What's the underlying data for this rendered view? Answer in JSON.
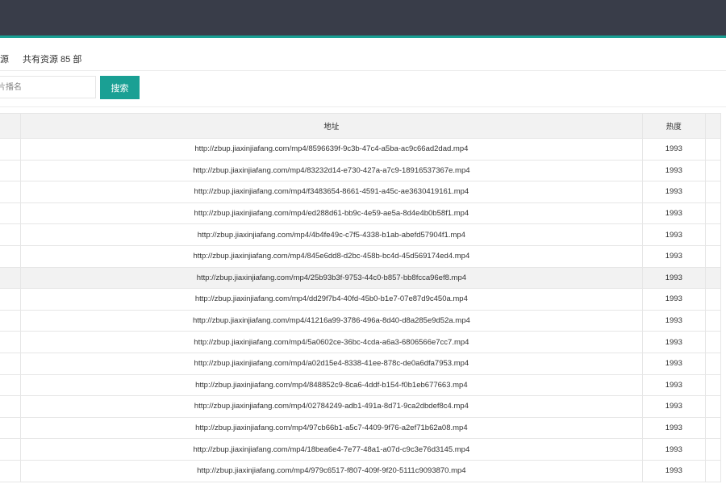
{
  "info": {
    "source_tail": "源",
    "total_text": "共有资源 85 部"
  },
  "search": {
    "placeholder": "片播名",
    "button_label": "搜索"
  },
  "table": {
    "columns": [
      "",
      "地址",
      "热度",
      ""
    ],
    "rows": [
      {
        "url": "http://zbup.jiaxinjiafang.com/mp4/8596639f-9c3b-47c4-a5ba-ac9c66ad2dad.mp4",
        "heat": "1993"
      },
      {
        "url": "http://zbup.jiaxinjiafang.com/mp4/83232d14-e730-427a-a7c9-18916537367e.mp4",
        "heat": "1993"
      },
      {
        "url": "http://zbup.jiaxinjiafang.com/mp4/f3483654-8661-4591-a45c-ae3630419161.mp4",
        "heat": "1993"
      },
      {
        "url": "http://zbup.jiaxinjiafang.com/mp4/ed288d61-bb9c-4e59-ae5a-8d4e4b0b58f1.mp4",
        "heat": "1993"
      },
      {
        "url": "http://zbup.jiaxinjiafang.com/mp4/4b4fe49c-c7f5-4338-b1ab-abefd57904f1.mp4",
        "heat": "1993"
      },
      {
        "url": "http://zbup.jiaxinjiafang.com/mp4/845e6dd8-d2bc-458b-bc4d-45d569174ed4.mp4",
        "heat": "1993"
      },
      {
        "url": "http://zbup.jiaxinjiafang.com/mp4/25b93b3f-9753-44c0-b857-bb8fcca96ef8.mp4",
        "heat": "1993"
      },
      {
        "url": "http://zbup.jiaxinjiafang.com/mp4/dd29f7b4-40fd-45b0-b1e7-07e87d9c450a.mp4",
        "heat": "1993"
      },
      {
        "url": "http://zbup.jiaxinjiafang.com/mp4/41216a99-3786-496a-8d40-d8a285e9d52a.mp4",
        "heat": "1993"
      },
      {
        "url": "http://zbup.jiaxinjiafang.com/mp4/5a0602ce-36bc-4cda-a6a3-6806566e7cc7.mp4",
        "heat": "1993"
      },
      {
        "url": "http://zbup.jiaxinjiafang.com/mp4/a02d15e4-8338-41ee-878c-de0a6dfa7953.mp4",
        "heat": "1993"
      },
      {
        "url": "http://zbup.jiaxinjiafang.com/mp4/848852c9-8ca6-4ddf-b154-f0b1eb677663.mp4",
        "heat": "1993"
      },
      {
        "url": "http://zbup.jiaxinjiafang.com/mp4/02784249-adb1-491a-8d71-9ca2dbdef8c4.mp4",
        "heat": "1993"
      },
      {
        "url": "http://zbup.jiaxinjiafang.com/mp4/97cb66b1-a5c7-4409-9f76-a2ef71b62a08.mp4",
        "heat": "1993"
      },
      {
        "url": "http://zbup.jiaxinjiafang.com/mp4/18bea6e4-7e77-48a1-a07d-c9c3e76d3145.mp4",
        "heat": "1993"
      },
      {
        "url": "http://zbup.jiaxinjiafang.com/mp4/979c6517-f807-409f-9f20-5111c9093870.mp4",
        "heat": "1993"
      }
    ]
  },
  "colors": {
    "topbar": "#393d49",
    "accent": "#1aa094",
    "header_bg": "#f2f2f2",
    "highlight_row": "#f2f2f2"
  }
}
